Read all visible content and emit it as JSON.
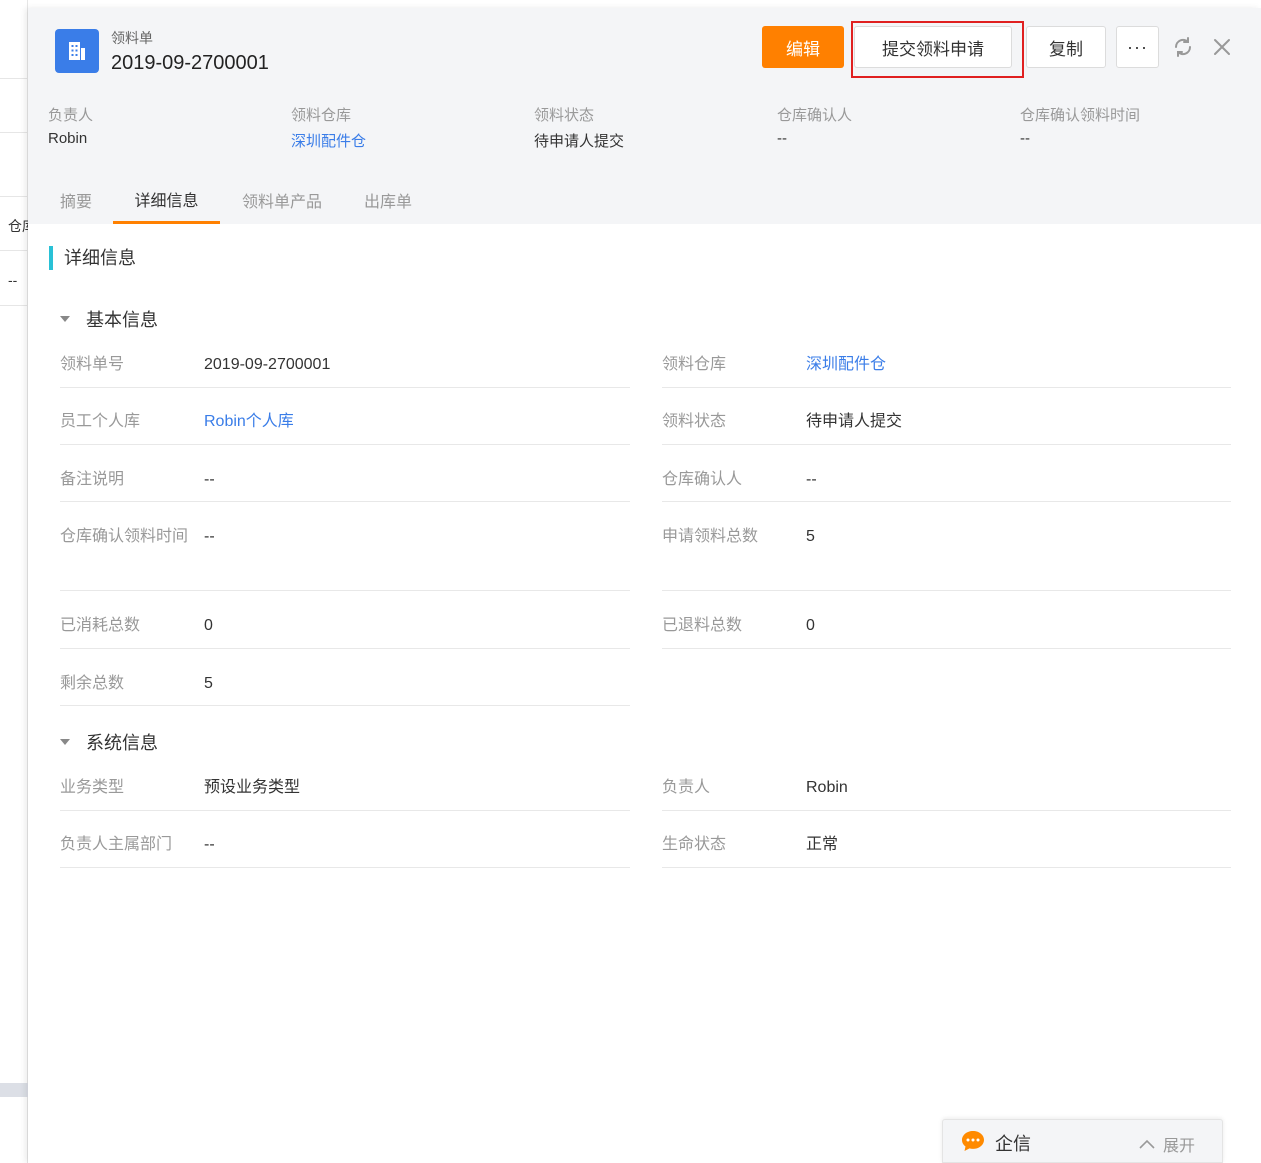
{
  "background": {
    "col_header": "仓库",
    "cell": "--"
  },
  "header": {
    "object_type": "领料单",
    "title": "2019-09-2700001",
    "buttons": {
      "edit": "编辑",
      "submit": "提交领料申请",
      "copy": "复制",
      "more": "···"
    }
  },
  "summary": [
    {
      "label": "负责人",
      "value": "Robin",
      "link": false
    },
    {
      "label": "领料仓库",
      "value": "深圳配件仓",
      "link": true
    },
    {
      "label": "领料状态",
      "value": "待申请人提交",
      "link": false
    },
    {
      "label": "仓库确认人",
      "value": "--",
      "link": false
    },
    {
      "label": "仓库确认领料时间",
      "value": "--",
      "link": false
    }
  ],
  "tabs": [
    {
      "label": "摘要",
      "active": false
    },
    {
      "label": "详细信息",
      "active": true
    },
    {
      "label": "领料单产品",
      "active": false
    },
    {
      "label": "出库单",
      "active": false
    }
  ],
  "section_title": "详细信息",
  "basic_info": {
    "title": "基本信息",
    "fields": [
      {
        "label": "领料单号",
        "value": "2019-09-2700001"
      },
      {
        "label": "领料仓库",
        "value": "深圳配件仓",
        "link": true
      },
      {
        "label": "员工个人库",
        "value": "Robin个人库",
        "link": true
      },
      {
        "label": "领料状态",
        "value": "待申请人提交"
      },
      {
        "label": "备注说明",
        "value": "--"
      },
      {
        "label": "仓库确认人",
        "value": "--"
      },
      {
        "label": "仓库确认领料时间",
        "value": "--"
      },
      {
        "label": "申请领料总数",
        "value": "5"
      },
      {
        "label": "已消耗总数",
        "value": "0"
      },
      {
        "label": "已退料总数",
        "value": "0"
      },
      {
        "label": "剩余总数",
        "value": "5"
      }
    ]
  },
  "system_info": {
    "title": "系统信息",
    "fields": [
      {
        "label": "业务类型",
        "value": "预设业务类型"
      },
      {
        "label": "负责人",
        "value": "Robin"
      },
      {
        "label": "负责人主属部门",
        "value": "--"
      },
      {
        "label": "生命状态",
        "value": "正常"
      }
    ]
  },
  "chat": {
    "title": "企信",
    "expand": "展开"
  },
  "colors": {
    "accent": "#ff8000",
    "link": "#3a7de8",
    "icon_bg": "#3a7de8",
    "section_bar": "#29c1d6",
    "highlight": "#e02020"
  }
}
